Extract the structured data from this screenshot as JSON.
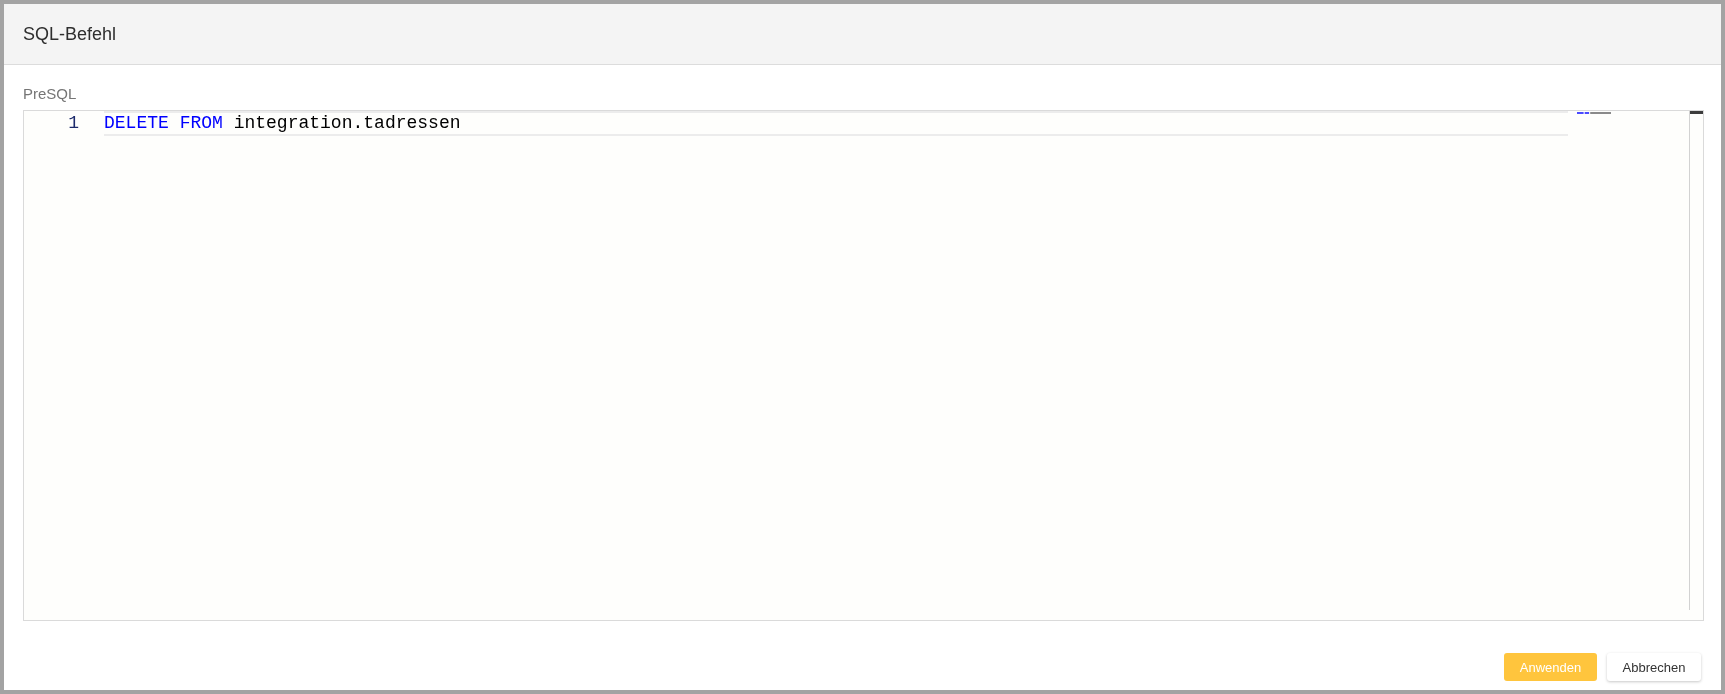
{
  "dialog": {
    "title": "SQL-Befehl"
  },
  "editor": {
    "label": "PreSQL",
    "lines": [
      {
        "number": "1",
        "current": true,
        "tokens": [
          {
            "kind": "keyword",
            "text": "DELETE"
          },
          {
            "kind": "keyword",
            "text": "FROM"
          },
          {
            "kind": "identifier",
            "text": "integration.tadressen"
          }
        ]
      }
    ]
  },
  "buttons": [
    {
      "label": "Anwenden",
      "kind": "primary"
    },
    {
      "label": "Abbrechen",
      "kind": "secondary"
    }
  ]
}
